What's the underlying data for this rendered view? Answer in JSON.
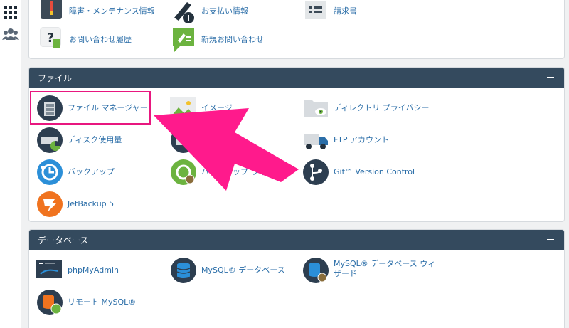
{
  "sidebar": {
    "icons": [
      "grid-icon",
      "users-icon"
    ]
  },
  "top_section": {
    "items": [
      {
        "label": "障害・メンテナンス情報",
        "icon": "thermometer-icon"
      },
      {
        "label": "お支払い情報",
        "icon": "pen-info-icon"
      },
      {
        "label": "請求書",
        "icon": "invoice-icon"
      },
      {
        "label": "お問い合わせ履歴",
        "icon": "question-icon"
      },
      {
        "label": "新規お問い合わせ",
        "icon": "new-inquiry-icon"
      }
    ]
  },
  "files_section": {
    "title": "ファイル",
    "items": [
      {
        "label": "ファイル マネージャー",
        "icon": "file-manager-icon"
      },
      {
        "label": "イメージ",
        "icon": "image-icon"
      },
      {
        "label": "ディレクトリ プライバシー",
        "icon": "folder-privacy-icon"
      },
      {
        "label": "ディスク使用量",
        "icon": "disk-usage-icon"
      },
      {
        "label": "",
        "icon": "ftp-accounts-icon"
      },
      {
        "label": "FTP アカウント",
        "icon": "ftp-truck-icon"
      },
      {
        "label": "バックアップ",
        "icon": "backup-icon"
      },
      {
        "label": "バックアップ ウィザード",
        "icon": "backup-wizard-icon"
      },
      {
        "label": "Git™ Version Control",
        "icon": "git-icon"
      },
      {
        "label": "JetBackup 5",
        "icon": "jetbackup-icon"
      }
    ]
  },
  "database_section": {
    "title": "データベース",
    "items": [
      {
        "label": "phpMyAdmin",
        "icon": "phpmyadmin-icon"
      },
      {
        "label": "MySQL® データベース",
        "icon": "mysql-db-icon"
      },
      {
        "label": "MySQL® データベース ウィザード",
        "icon": "mysql-wizard-icon"
      },
      {
        "label": "リモート MySQL®",
        "icon": "remote-mysql-icon"
      }
    ]
  },
  "annotation": {
    "arrow_color": "#ff1a8c",
    "highlight_color": "#e8177f"
  }
}
